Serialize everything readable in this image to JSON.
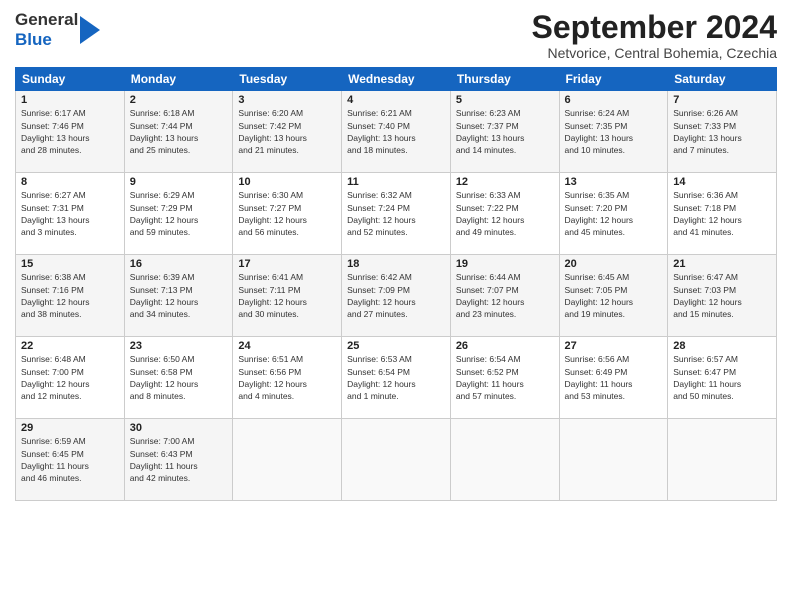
{
  "header": {
    "logo_general": "General",
    "logo_blue": "Blue",
    "month_title": "September 2024",
    "location": "Netvorice, Central Bohemia, Czechia"
  },
  "days_of_week": [
    "Sunday",
    "Monday",
    "Tuesday",
    "Wednesday",
    "Thursday",
    "Friday",
    "Saturday"
  ],
  "weeks": [
    [
      {
        "day": "1",
        "info": "Sunrise: 6:17 AM\nSunset: 7:46 PM\nDaylight: 13 hours\nand 28 minutes."
      },
      {
        "day": "2",
        "info": "Sunrise: 6:18 AM\nSunset: 7:44 PM\nDaylight: 13 hours\nand 25 minutes."
      },
      {
        "day": "3",
        "info": "Sunrise: 6:20 AM\nSunset: 7:42 PM\nDaylight: 13 hours\nand 21 minutes."
      },
      {
        "day": "4",
        "info": "Sunrise: 6:21 AM\nSunset: 7:40 PM\nDaylight: 13 hours\nand 18 minutes."
      },
      {
        "day": "5",
        "info": "Sunrise: 6:23 AM\nSunset: 7:37 PM\nDaylight: 13 hours\nand 14 minutes."
      },
      {
        "day": "6",
        "info": "Sunrise: 6:24 AM\nSunset: 7:35 PM\nDaylight: 13 hours\nand 10 minutes."
      },
      {
        "day": "7",
        "info": "Sunrise: 6:26 AM\nSunset: 7:33 PM\nDaylight: 13 hours\nand 7 minutes."
      }
    ],
    [
      {
        "day": "8",
        "info": "Sunrise: 6:27 AM\nSunset: 7:31 PM\nDaylight: 13 hours\nand 3 minutes."
      },
      {
        "day": "9",
        "info": "Sunrise: 6:29 AM\nSunset: 7:29 PM\nDaylight: 12 hours\nand 59 minutes."
      },
      {
        "day": "10",
        "info": "Sunrise: 6:30 AM\nSunset: 7:27 PM\nDaylight: 12 hours\nand 56 minutes."
      },
      {
        "day": "11",
        "info": "Sunrise: 6:32 AM\nSunset: 7:24 PM\nDaylight: 12 hours\nand 52 minutes."
      },
      {
        "day": "12",
        "info": "Sunrise: 6:33 AM\nSunset: 7:22 PM\nDaylight: 12 hours\nand 49 minutes."
      },
      {
        "day": "13",
        "info": "Sunrise: 6:35 AM\nSunset: 7:20 PM\nDaylight: 12 hours\nand 45 minutes."
      },
      {
        "day": "14",
        "info": "Sunrise: 6:36 AM\nSunset: 7:18 PM\nDaylight: 12 hours\nand 41 minutes."
      }
    ],
    [
      {
        "day": "15",
        "info": "Sunrise: 6:38 AM\nSunset: 7:16 PM\nDaylight: 12 hours\nand 38 minutes."
      },
      {
        "day": "16",
        "info": "Sunrise: 6:39 AM\nSunset: 7:13 PM\nDaylight: 12 hours\nand 34 minutes."
      },
      {
        "day": "17",
        "info": "Sunrise: 6:41 AM\nSunset: 7:11 PM\nDaylight: 12 hours\nand 30 minutes."
      },
      {
        "day": "18",
        "info": "Sunrise: 6:42 AM\nSunset: 7:09 PM\nDaylight: 12 hours\nand 27 minutes."
      },
      {
        "day": "19",
        "info": "Sunrise: 6:44 AM\nSunset: 7:07 PM\nDaylight: 12 hours\nand 23 minutes."
      },
      {
        "day": "20",
        "info": "Sunrise: 6:45 AM\nSunset: 7:05 PM\nDaylight: 12 hours\nand 19 minutes."
      },
      {
        "day": "21",
        "info": "Sunrise: 6:47 AM\nSunset: 7:03 PM\nDaylight: 12 hours\nand 15 minutes."
      }
    ],
    [
      {
        "day": "22",
        "info": "Sunrise: 6:48 AM\nSunset: 7:00 PM\nDaylight: 12 hours\nand 12 minutes."
      },
      {
        "day": "23",
        "info": "Sunrise: 6:50 AM\nSunset: 6:58 PM\nDaylight: 12 hours\nand 8 minutes."
      },
      {
        "day": "24",
        "info": "Sunrise: 6:51 AM\nSunset: 6:56 PM\nDaylight: 12 hours\nand 4 minutes."
      },
      {
        "day": "25",
        "info": "Sunrise: 6:53 AM\nSunset: 6:54 PM\nDaylight: 12 hours\nand 1 minute."
      },
      {
        "day": "26",
        "info": "Sunrise: 6:54 AM\nSunset: 6:52 PM\nDaylight: 11 hours\nand 57 minutes."
      },
      {
        "day": "27",
        "info": "Sunrise: 6:56 AM\nSunset: 6:49 PM\nDaylight: 11 hours\nand 53 minutes."
      },
      {
        "day": "28",
        "info": "Sunrise: 6:57 AM\nSunset: 6:47 PM\nDaylight: 11 hours\nand 50 minutes."
      }
    ],
    [
      {
        "day": "29",
        "info": "Sunrise: 6:59 AM\nSunset: 6:45 PM\nDaylight: 11 hours\nand 46 minutes."
      },
      {
        "day": "30",
        "info": "Sunrise: 7:00 AM\nSunset: 6:43 PM\nDaylight: 11 hours\nand 42 minutes."
      },
      {
        "day": "",
        "info": ""
      },
      {
        "day": "",
        "info": ""
      },
      {
        "day": "",
        "info": ""
      },
      {
        "day": "",
        "info": ""
      },
      {
        "day": "",
        "info": ""
      }
    ]
  ]
}
